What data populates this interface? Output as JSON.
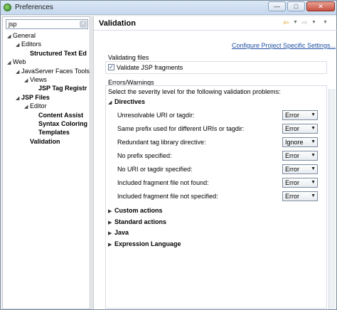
{
  "window": {
    "title": "Preferences"
  },
  "filter": {
    "value": "jsp"
  },
  "tree": [
    {
      "label": "General",
      "indent": 0,
      "twisty": "open",
      "bold": false
    },
    {
      "label": "Editors",
      "indent": 1,
      "twisty": "open",
      "bold": false
    },
    {
      "label": "Structured Text Ed",
      "indent": 2,
      "twisty": "",
      "bold": true
    },
    {
      "label": "Web",
      "indent": 0,
      "twisty": "open",
      "bold": false
    },
    {
      "label": "JavaServer Faces Tools",
      "indent": 1,
      "twisty": "open",
      "bold": false
    },
    {
      "label": "Views",
      "indent": 2,
      "twisty": "open",
      "bold": false
    },
    {
      "label": "JSP Tag Registr",
      "indent": 3,
      "twisty": "",
      "bold": true
    },
    {
      "label": "JSP Files",
      "indent": 1,
      "twisty": "open",
      "bold": true
    },
    {
      "label": "Editor",
      "indent": 2,
      "twisty": "open",
      "bold": false
    },
    {
      "label": "Content Assist",
      "indent": 3,
      "twisty": "",
      "bold": true
    },
    {
      "label": "Syntax Coloring",
      "indent": 3,
      "twisty": "",
      "bold": true
    },
    {
      "label": "Templates",
      "indent": 3,
      "twisty": "",
      "bold": true
    },
    {
      "label": "Validation",
      "indent": 2,
      "twisty": "",
      "bold": true
    }
  ],
  "page": {
    "title": "Validation",
    "config_link": "Configure Project Specific Settings...",
    "validating_files": {
      "heading": "Validating files",
      "checkbox_label": "Validate JSP fragments",
      "checked": true
    },
    "errors_warnings": {
      "heading": "Errors/Warnings",
      "description": "Select the severity level for the following validation problems:",
      "directives_label": "Directives",
      "rows": [
        {
          "label": "Unresolvable URI or tagdir:",
          "value": "Error"
        },
        {
          "label": "Same prefix used for different URIs or tagdir:",
          "value": "Error"
        },
        {
          "label": "Redundant tag library directive:",
          "value": "Ignore"
        },
        {
          "label": "No prefix specified:",
          "value": "Error"
        },
        {
          "label": "No URI or tagdir specified:",
          "value": "Error"
        },
        {
          "label": "Included fragment file not found:",
          "value": "Error"
        },
        {
          "label": "Included fragment file not specified:",
          "value": "Error"
        }
      ],
      "collapsed_sections": [
        "Custom actions",
        "Standard actions",
        "Java",
        "Expression Language"
      ]
    }
  }
}
